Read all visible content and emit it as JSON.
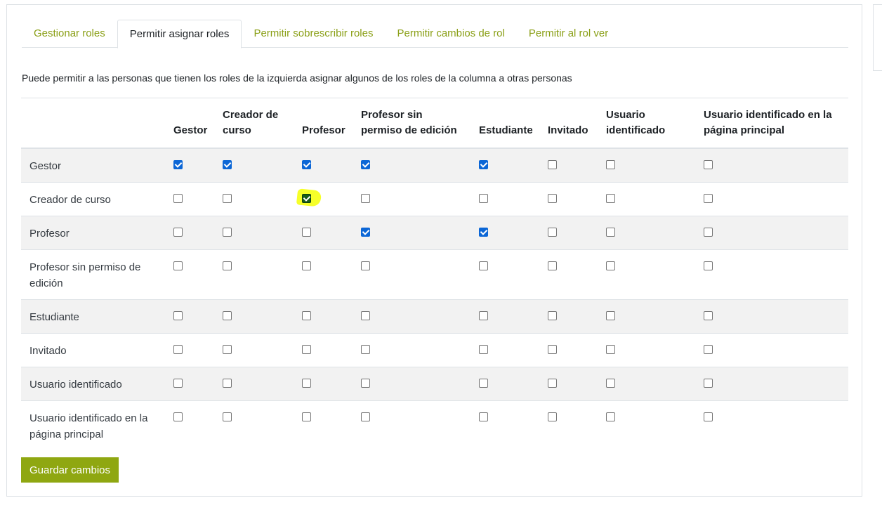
{
  "tabs": [
    {
      "label": "Gestionar roles",
      "active": false
    },
    {
      "label": "Permitir asignar roles",
      "active": true
    },
    {
      "label": "Permitir sobrescribir roles",
      "active": false
    },
    {
      "label": "Permitir cambios de rol",
      "active": false
    },
    {
      "label": "Permitir al rol ver",
      "active": false
    }
  ],
  "description": "Puede permitir a las personas que tienen los roles de la izquierda asignar algunos de los roles de la columna a otras personas",
  "table": {
    "columns": [
      "Gestor",
      "Creador de curso",
      "Profesor",
      "Profesor sin permiso de edición",
      "Estudiante",
      "Invitado",
      "Usuario identificado",
      "Usuario identificado en la página principal"
    ],
    "rows": [
      {
        "label": "Gestor",
        "checks": [
          true,
          true,
          true,
          true,
          true,
          false,
          false,
          false
        ]
      },
      {
        "label": "Creador de curso",
        "checks": [
          false,
          false,
          true,
          false,
          false,
          false,
          false,
          false
        ],
        "highlight_col": 2
      },
      {
        "label": "Profesor",
        "checks": [
          false,
          false,
          false,
          true,
          true,
          false,
          false,
          false
        ]
      },
      {
        "label": "Profesor sin permiso de edición",
        "checks": [
          false,
          false,
          false,
          false,
          false,
          false,
          false,
          false
        ]
      },
      {
        "label": "Estudiante",
        "checks": [
          false,
          false,
          false,
          false,
          false,
          false,
          false,
          false
        ]
      },
      {
        "label": "Invitado",
        "checks": [
          false,
          false,
          false,
          false,
          false,
          false,
          false,
          false
        ]
      },
      {
        "label": "Usuario identificado",
        "checks": [
          false,
          false,
          false,
          false,
          false,
          false,
          false,
          false
        ]
      },
      {
        "label": "Usuario identificado en la página principal",
        "checks": [
          false,
          false,
          false,
          false,
          false,
          false,
          false,
          false
        ]
      }
    ]
  },
  "save_button": "Guardar cambios",
  "colors": {
    "accent": "#8fa711",
    "checkbox_checked": "#0b66d6",
    "highlight": "#f5ff1e"
  }
}
